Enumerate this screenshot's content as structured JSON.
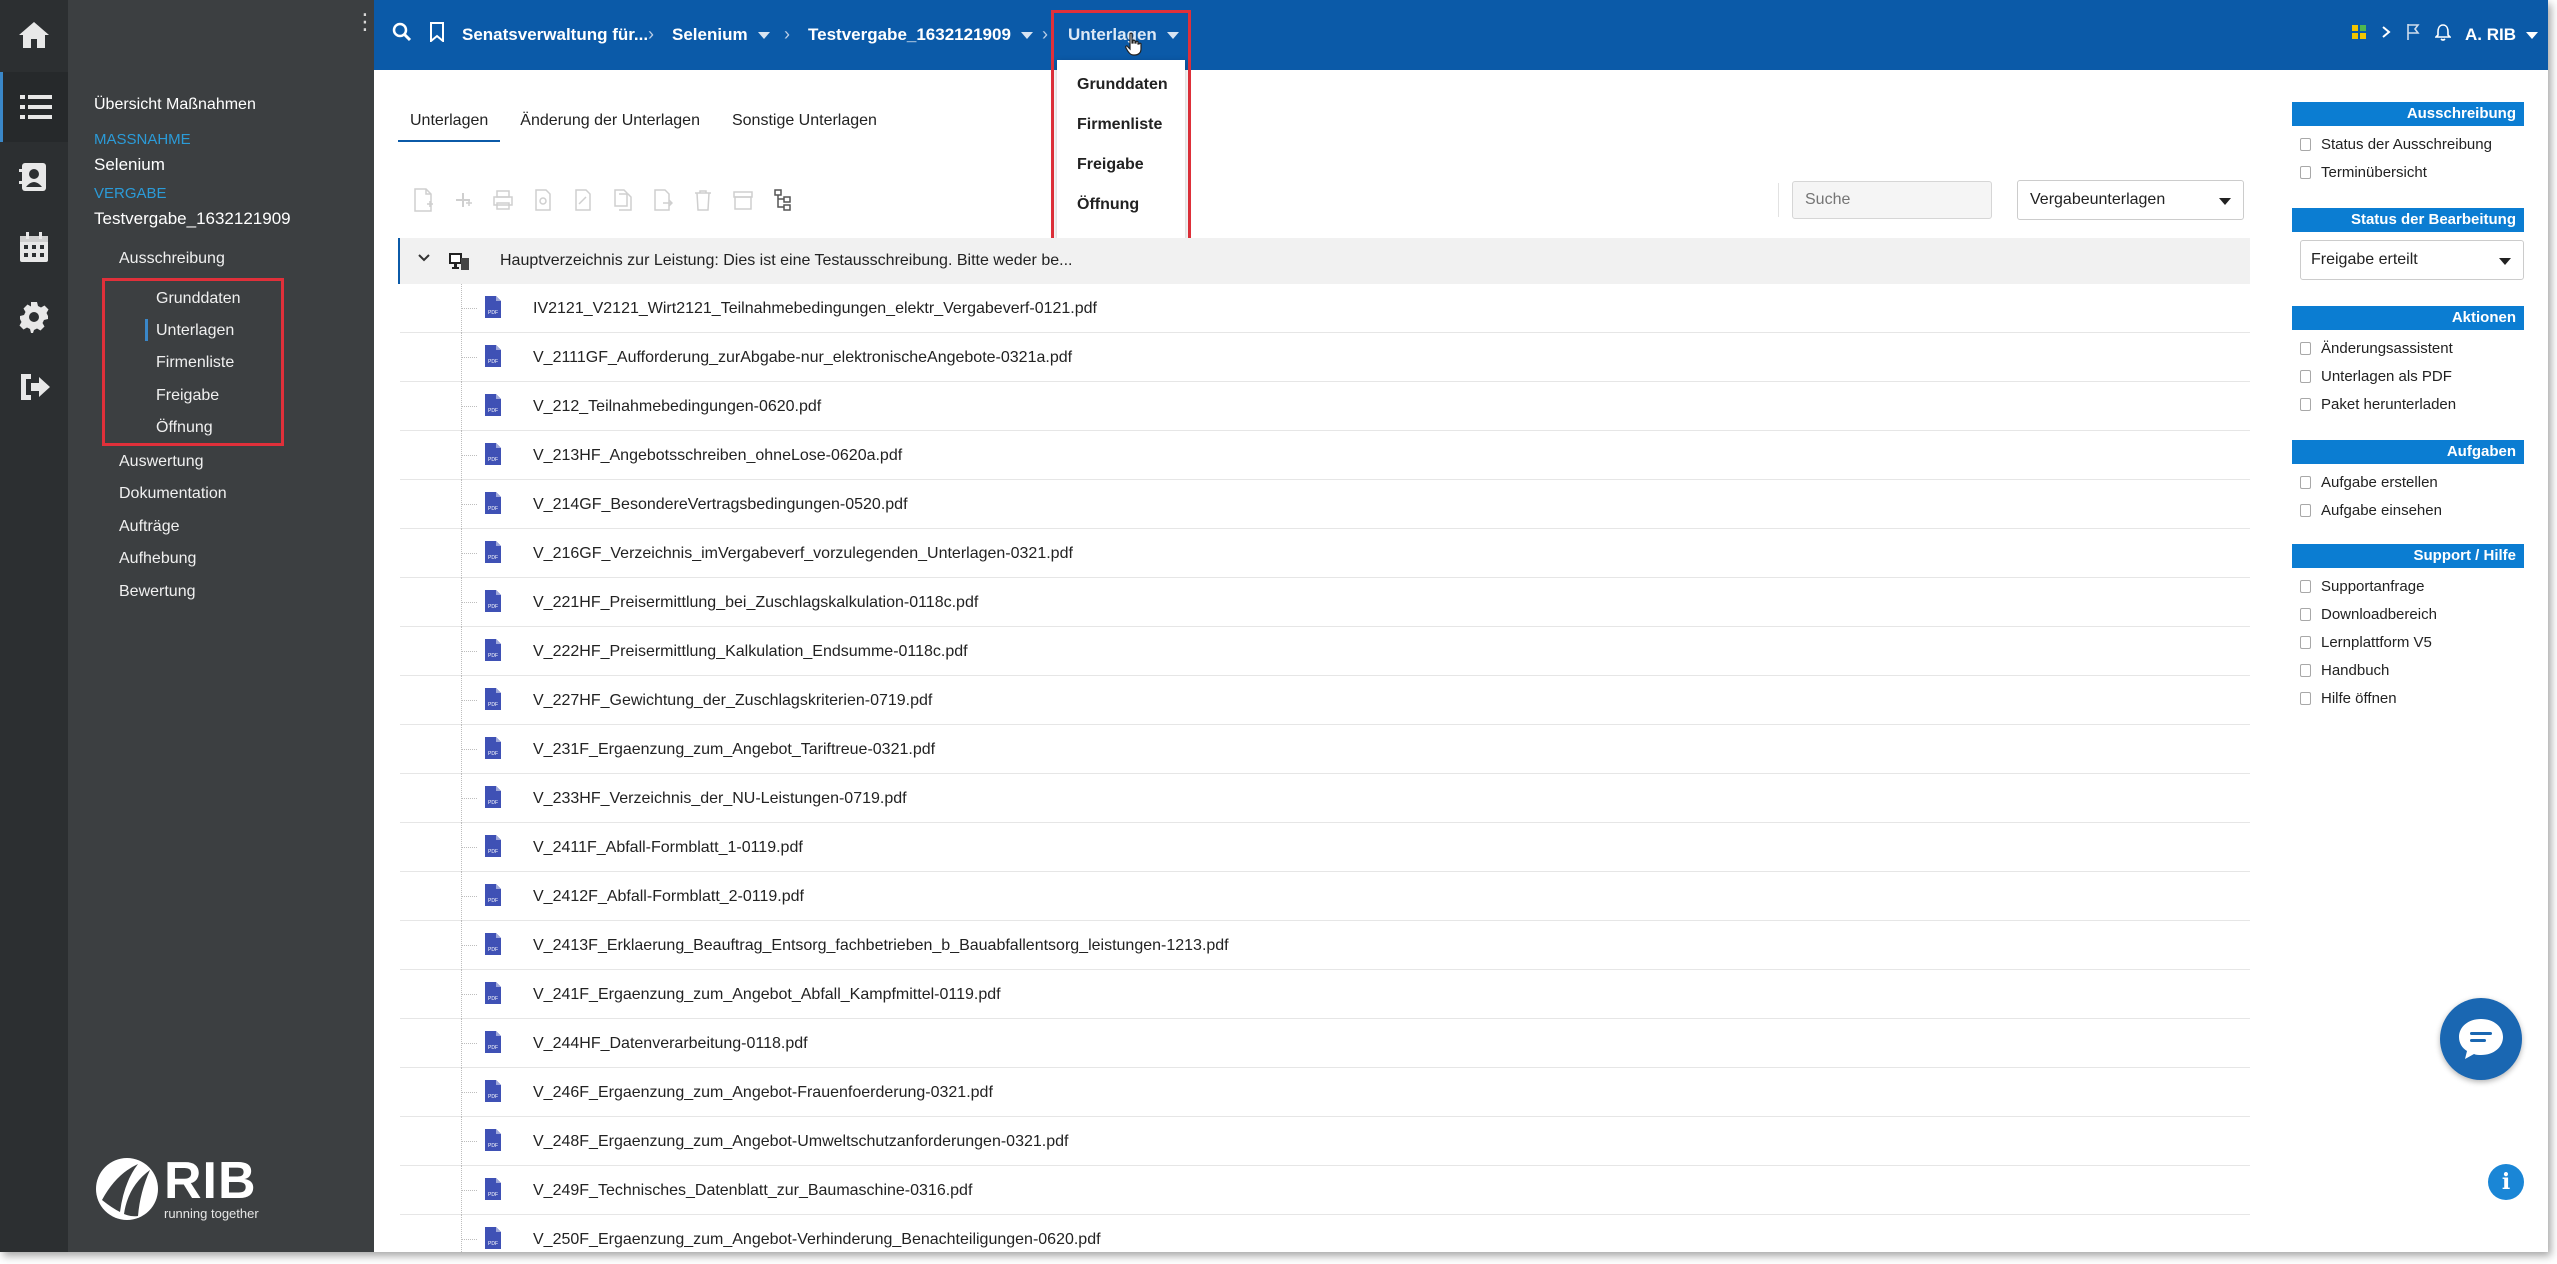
{
  "topbar": {
    "breadcrumbs": [
      "Senatsverwaltung für...",
      "Selenium",
      "Testvergabe_1632121909",
      "Unterlagen"
    ],
    "user": "A. RIB"
  },
  "dropdown": {
    "items": [
      "Grunddaten",
      "Firmenliste",
      "Freigabe",
      "Öffnung"
    ]
  },
  "nav": {
    "overview": "Übersicht Maßnahmen",
    "massnahme_label": "Maßnahme",
    "massnahme_value": "Selenium",
    "vergabe_label": "Vergabe",
    "vergabe_value": "Testvergabe_1632121909",
    "ausschreibung": "Ausschreibung",
    "sub_items": [
      "Grunddaten",
      "Unterlagen",
      "Firmenliste",
      "Freigabe",
      "Öffnung"
    ],
    "items": [
      "Auswertung",
      "Dokumentation",
      "Aufträge",
      "Aufhebung",
      "Bewertung"
    ],
    "logo_text": "RIB",
    "logo_tagline": "running together"
  },
  "tabs": [
    "Unterlagen",
    "Änderung der Unterlagen",
    "Sonstige Unterlagen"
  ],
  "search": {
    "placeholder": "Suche"
  },
  "select": {
    "value": "Vergabeunterlagen"
  },
  "tree": {
    "header": "Hauptverzeichnis zur Leistung: Dies ist eine Testausschreibung. Bitte weder be...",
    "files": [
      "IV2121_V2121_Wirt2121_Teilnahmebedingungen_elektr_Vergabeverf-0121.pdf",
      "V_2111GF_Aufforderung_zurAbgabe-nur_elektronischeAngebote-0321a.pdf",
      "V_212_Teilnahmebedingungen-0620.pdf",
      "V_213HF_Angebotsschreiben_ohneLose-0620a.pdf",
      "V_214GF_BesondereVertragsbedingungen-0520.pdf",
      "V_216GF_Verzeichnis_imVergabeverf_vorzulegenden_Unterlagen-0321.pdf",
      "V_221HF_Preisermittlung_bei_Zuschlagskalkulation-0118c.pdf",
      "V_222HF_Preisermittlung_Kalkulation_Endsumme-0118c.pdf",
      "V_227HF_Gewichtung_der_Zuschlagskriterien-0719.pdf",
      "V_231F_Ergaenzung_zum_Angebot_Tariftreue-0321.pdf",
      "V_233HF_Verzeichnis_der_NU-Leistungen-0719.pdf",
      "V_2411F_Abfall-Formblatt_1-0119.pdf",
      "V_2412F_Abfall-Formblatt_2-0119.pdf",
      "V_2413F_Erklaerung_Beauftrag_Entsorg_fachbetrieben_b_Bauabfallentsorg_leistungen-1213.pdf",
      "V_241F_Ergaenzung_zum_Angebot_Abfall_Kampfmittel-0119.pdf",
      "V_244HF_Datenverarbeitung-0118.pdf",
      "V_246F_Ergaenzung_zum_Angebot-Frauenfoerderung-0321.pdf",
      "V_248F_Ergaenzung_zum_Angebot-Umweltschutzanforderungen-0321.pdf",
      "V_249F_Technisches_Datenblatt_zur_Baumaschine-0316.pdf",
      "V_250F_Ergaenzung_zum_Angebot-Verhinderung_Benachteiligungen-0620.pdf"
    ]
  },
  "sidebar": {
    "ausschreibung": {
      "title": "Ausschreibung",
      "links": [
        "Status der Ausschreibung",
        "Terminübersicht"
      ]
    },
    "status": {
      "title": "Status der Bearbeitung",
      "value": "Freigabe erteilt"
    },
    "aktionen": {
      "title": "Aktionen",
      "links": [
        "Änderungsassistent",
        "Unterlagen als PDF",
        "Paket herunterladen"
      ]
    },
    "aufgaben": {
      "title": "Aufgaben",
      "links": [
        "Aufgabe erstellen",
        "Aufgabe einsehen"
      ]
    },
    "support": {
      "title": "Support / Hilfe",
      "links": [
        "Supportanfrage",
        "Downloadbereich",
        "Lernplattform V5",
        "Handbuch",
        "Hilfe öffnen"
      ]
    }
  },
  "colors": {
    "primary": "#0b5aa8",
    "accent": "#0b7dd2",
    "nav_bg": "#3c3f41",
    "rail_bg": "#2c2f31",
    "highlight": "#e0303a"
  }
}
